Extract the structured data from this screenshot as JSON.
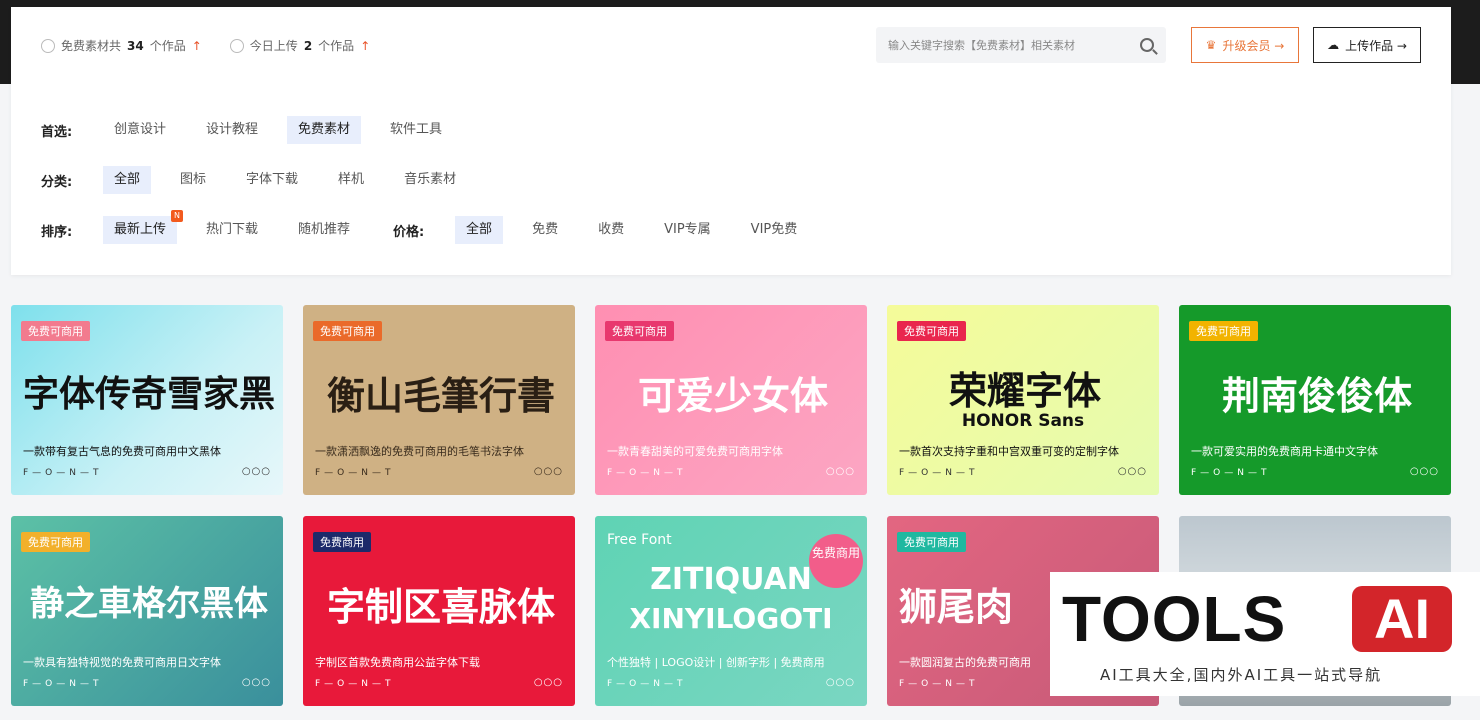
{
  "stats": {
    "free_prefix": "免费素材共",
    "free_count": "34",
    "free_suffix": "个作品",
    "today_prefix": "今日上传",
    "today_count": "2",
    "today_suffix": "个作品"
  },
  "search": {
    "placeholder": "输入关键字搜索【免费素材】相关素材"
  },
  "buttons": {
    "vip": "升级会员 →",
    "upload": "上传作品 →"
  },
  "filters": {
    "pref": {
      "label": "首选:",
      "options": [
        "创意设计",
        "设计教程",
        "免费素材",
        "软件工具"
      ]
    },
    "cat": {
      "label": "分类:",
      "options": [
        "全部",
        "图标",
        "字体下载",
        "样机",
        "音乐素材"
      ]
    },
    "sort": {
      "label": "排序:",
      "options": [
        "最新上传",
        "热门下载",
        "随机推荐"
      ],
      "new_badge": "N"
    },
    "price": {
      "label": "价格:",
      "options": [
        "全部",
        "免费",
        "收费",
        "VIP专属",
        "VIP免费"
      ]
    }
  },
  "cards": [
    {
      "tag": "免费可商用",
      "title": "字体传奇雪家黑",
      "desc": "一款带有复古气息的免费可商用中文黑体",
      "font": "F—O—N—T",
      "dots": "○○○"
    },
    {
      "tag": "免费可商用",
      "title": "衡山毛筆行書",
      "desc": "一款潇洒飘逸的免费可商用的毛笔书法字体",
      "font": "F—O—N—T",
      "dots": "○○○"
    },
    {
      "tag": "免费可商用",
      "title": "可爱少女体",
      "desc": "一款青春甜美的可爱免费可商用字体",
      "font": "F—O—N—T",
      "dots": "○○○"
    },
    {
      "tag": "免费可商用",
      "title": "荣耀字体",
      "subtitle": "HONOR Sans",
      "desc": "一款首次支持字重和中宫双重可变的定制字体",
      "font": "F—O—N—T",
      "dots": "○○○"
    },
    {
      "tag": "免费可商用",
      "title": "荆南俊俊体",
      "desc": "一款可爱实用的免费商用卡通中文字体",
      "font": "F—O—N—T",
      "dots": "○○○"
    },
    {
      "tag": "免费可商用",
      "title": "静之車格尔黑体",
      "desc": "一款具有独特视觉的免费可商用日文字体",
      "font": "F—O—N—T",
      "dots": "○○○"
    },
    {
      "tag": "免费商用",
      "title": "字制区喜脉体",
      "desc": "字制区首款免费商用公益字体下载",
      "font": "F—O—N—T",
      "dots": "○○○"
    },
    {
      "top": "Free Font",
      "title": "ZITIQUAN",
      "title2": "XINYILOGOTI",
      "desc": "个性独特 | LOGO设计 | 创新字形 | 免费商用",
      "font": "F—O—N—T",
      "dots": "○○○",
      "stamp": "免费商用"
    },
    {
      "tag": "免费可商用",
      "title": "狮尾肉",
      "desc": "一款圆润复古的免费可商用",
      "font": "F—O—N—T",
      "dots": "○○○"
    }
  ],
  "watermark": {
    "tools": "TOOLS",
    "ai": "AI",
    "sub": "AI工具大全,国内外AI工具一站式导航"
  },
  "colors": {
    "accent": "#e8763a",
    "selected_bg": "#e8eefc",
    "up_arrow": "#e8542a",
    "new_badge": "#f25a1e"
  }
}
